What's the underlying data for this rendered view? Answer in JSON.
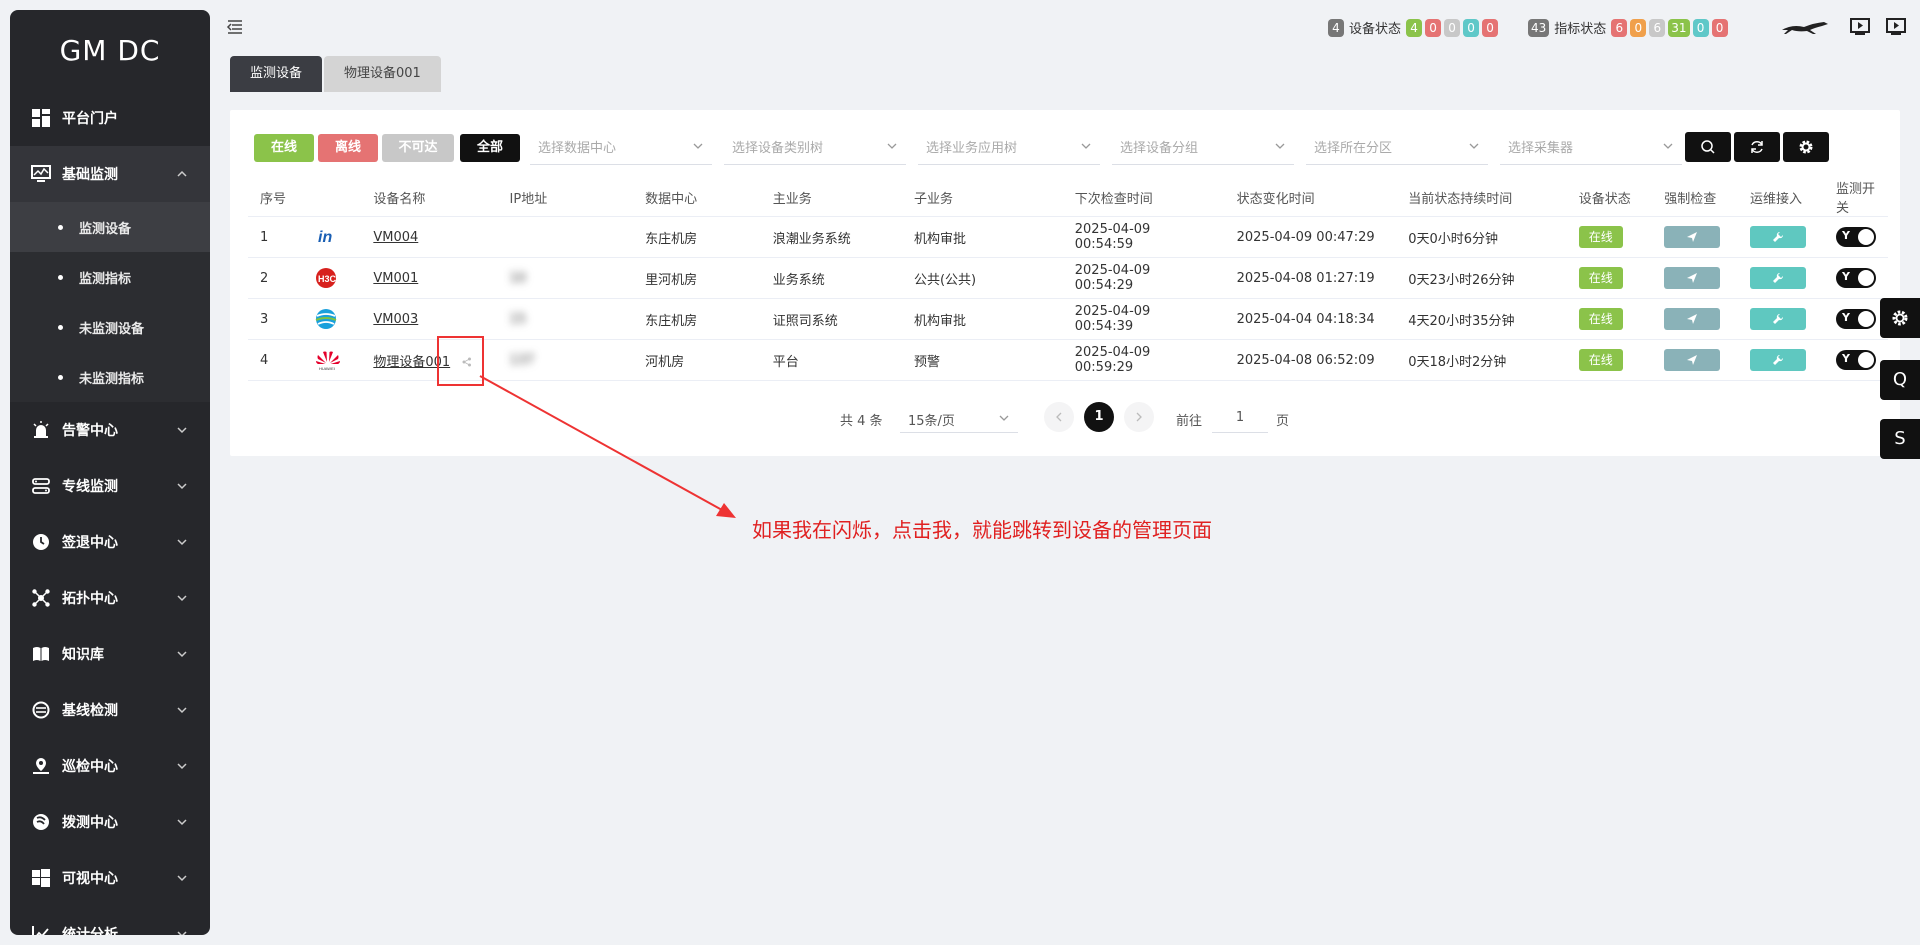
{
  "app": {
    "logo": "GM DC"
  },
  "sidebar": {
    "items": [
      {
        "label": "平台门户",
        "icon": "dashboard-icon"
      },
      {
        "label": "基础监测",
        "icon": "monitor-icon",
        "open": true,
        "children": [
          {
            "label": "监测设备",
            "active": true
          },
          {
            "label": "监测指标"
          },
          {
            "label": "未监测设备"
          },
          {
            "label": "未监测指标"
          }
        ]
      },
      {
        "label": "告警中心",
        "icon": "alarm-icon"
      },
      {
        "label": "专线监测",
        "icon": "line-icon"
      },
      {
        "label": "签退中心",
        "icon": "clock-icon"
      },
      {
        "label": "拓扑中心",
        "icon": "topology-icon"
      },
      {
        "label": "知识库",
        "icon": "book-icon"
      },
      {
        "label": "基线检测",
        "icon": "baseline-icon"
      },
      {
        "label": "巡检中心",
        "icon": "pin-icon"
      },
      {
        "label": "拨测中心",
        "icon": "dial-icon"
      },
      {
        "label": "可视中心",
        "icon": "windows-icon"
      },
      {
        "label": "统计分析",
        "icon": "chart-icon"
      }
    ]
  },
  "header": {
    "device_status": {
      "count": "4",
      "label": "设备状态",
      "badges": [
        "4",
        "0",
        "0",
        "0",
        "0"
      ]
    },
    "metric_status": {
      "count": "43",
      "label": "指标状态",
      "badges": [
        "6",
        "0",
        "6",
        "31",
        "0",
        "0"
      ]
    }
  },
  "tabs": [
    "监测设备",
    "物理设备001"
  ],
  "filters": {
    "buttons": [
      "在线",
      "离线",
      "不可达",
      "全部"
    ],
    "selects": [
      "选择数据中心",
      "选择设备类别树",
      "选择业务应用树",
      "选择设备分组",
      "选择所在分区",
      "选择采集器"
    ]
  },
  "table": {
    "headers": [
      "序号",
      "设备名称",
      "IP地址",
      "数据中心",
      "主业务",
      "子业务",
      "下次检查时间",
      "状态变化时间",
      "当前状态持续时间",
      "设备状态",
      "强制检查",
      "运维接入",
      "监测开关"
    ],
    "rows": [
      {
        "no": "1",
        "logo": "inspur-logo",
        "name": "VM004",
        "ip": "",
        "dc": "东庄机房",
        "main": "浪潮业务系统",
        "sub": "机构审批",
        "next": "2025-04-09 00:54:59",
        "changed": "2025-04-09 00:47:29",
        "duration": "0天0小时6分钟",
        "status": "在线",
        "switch": "Y"
      },
      {
        "no": "2",
        "logo": "h3c-logo",
        "name": "VM001",
        "ip": "10",
        "dc": "里河机房",
        "main": "业务系统",
        "sub": "公共(公共)",
        "next": "2025-04-09 00:54:29",
        "changed": "2025-04-08 01:27:19",
        "duration": "0天23小时26分钟",
        "status": "在线",
        "switch": "Y"
      },
      {
        "no": "3",
        "logo": "globe-logo",
        "name": "VM003",
        "ip": "15",
        "dc": "东庄机房",
        "main": "证照司系统",
        "sub": "机构审批",
        "next": "2025-04-09 00:54:39",
        "changed": "2025-04-04 04:18:34",
        "duration": "4天20小时35分钟",
        "status": "在线",
        "switch": "Y"
      },
      {
        "no": "4",
        "logo": "huawei-logo",
        "name": "物理设备001",
        "ip": "137",
        "dc": "河机房",
        "main": "平台",
        "sub": "预警",
        "next": "2025-04-09 00:59:29",
        "changed": "2025-04-08 06:52:09",
        "duration": "0天18小时2分钟",
        "status": "在线",
        "switch": "Y"
      }
    ]
  },
  "pager": {
    "total": "共 4 条",
    "size": "15条/页",
    "current": "1",
    "goto_label": "前往",
    "goto_value": "1",
    "page_unit": "页"
  },
  "float_buttons": [
    "Q",
    "S"
  ],
  "annotation": "如果我在闪烁，点击我，就能跳转到设备的管理页面",
  "colors": {
    "online": "#8bc34a",
    "offline": "#e57373",
    "unreachable": "#c8c8c8",
    "all": "#111111",
    "teal": "#5fc8c0",
    "slate": "#8ab2b8"
  }
}
